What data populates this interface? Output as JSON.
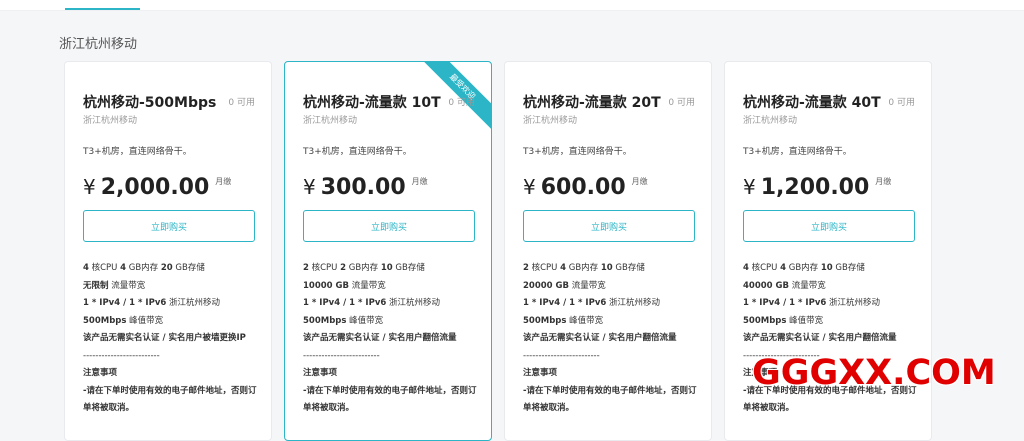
{
  "region_title": "浙江杭州移动",
  "buy_label": "立即购买",
  "currency": "¥",
  "period": "月缴",
  "ribbon_text": "最受欢迎",
  "plans": [
    {
      "name": "杭州移动-500Mbps",
      "available": "0 可用",
      "region": "浙江杭州移动",
      "desc": "T3+机房，直连网络骨干。",
      "price": "2,000.00",
      "cpu": "4",
      "cpu_label": "核CPU",
      "ram": "4",
      "ram_label": "GB内存",
      "disk": "20",
      "disk_label": "GB存储",
      "traffic": "无限制",
      "traffic_label": "流量带宽",
      "ip": "1 * IPv4 / 1 * IPv6",
      "ip_label": "浙江杭州移动",
      "bw": "500Mbps",
      "bw_label": "峰值带宽",
      "note": "该产品无需实名认证 / 实名用户被墙更换IP",
      "divider": "-------------------------",
      "notice_title": "注意事项",
      "notice_1": "-请在下单时使用有效的电子邮件地址，否则订单将被取消。"
    },
    {
      "name": "杭州移动-流量款 10T",
      "available": "0 可用",
      "region": "浙江杭州移动",
      "desc": "T3+机房，直连网络骨干。",
      "price": "300.00",
      "cpu": "2",
      "cpu_label": "核CPU",
      "ram": "2",
      "ram_label": "GB内存",
      "disk": "10",
      "disk_label": "GB存储",
      "traffic": "10000 GB",
      "traffic_label": "流量带宽",
      "ip": "1 * IPv4 / 1 * IPv6",
      "ip_label": "浙江杭州移动",
      "bw": "500Mbps",
      "bw_label": "峰值带宽",
      "note": "该产品无需实名认证 / 实名用户翻倍流量",
      "divider": "-------------------------",
      "notice_title": "注意事项",
      "notice_1": "-请在下单时使用有效的电子邮件地址，否则订单将被取消。"
    },
    {
      "name": "杭州移动-流量款 20T",
      "available": "0 可用",
      "region": "浙江杭州移动",
      "desc": "T3+机房，直连网络骨干。",
      "price": "600.00",
      "cpu": "2",
      "cpu_label": "核CPU",
      "ram": "4",
      "ram_label": "GB内存",
      "disk": "10",
      "disk_label": "GB存储",
      "traffic": "20000 GB",
      "traffic_label": "流量带宽",
      "ip": "1 * IPv4 / 1 * IPv6",
      "ip_label": "浙江杭州移动",
      "bw": "500Mbps",
      "bw_label": "峰值带宽",
      "note": "该产品无需实名认证 / 实名用户翻倍流量",
      "divider": "-------------------------",
      "notice_title": "注意事项",
      "notice_1": "-请在下单时使用有效的电子邮件地址，否则订单将被取消。"
    },
    {
      "name": "杭州移动-流量款 40T",
      "available": "0 可用",
      "region": "浙江杭州移动",
      "desc": "T3+机房，直连网络骨干。",
      "price": "1,200.00",
      "cpu": "4",
      "cpu_label": "核CPU",
      "ram": "4",
      "ram_label": "GB内存",
      "disk": "10",
      "disk_label": "GB存储",
      "traffic": "40000 GB",
      "traffic_label": "流量带宽",
      "ip": "1 * IPv4 / 1 * IPv6",
      "ip_label": "浙江杭州移动",
      "bw": "500Mbps",
      "bw_label": "峰值带宽",
      "note": "该产品无需实名认证 / 实名用户翻倍流量",
      "divider": "-------------------------",
      "notice_title": "注意事项",
      "notice_1": "-请在下单时使用有效的电子邮件地址，否则订单将被取消。"
    }
  ],
  "watermark": "GGGXX.COM",
  "accent_color": "#2bb5c6",
  "watermark_color": "#e00000"
}
